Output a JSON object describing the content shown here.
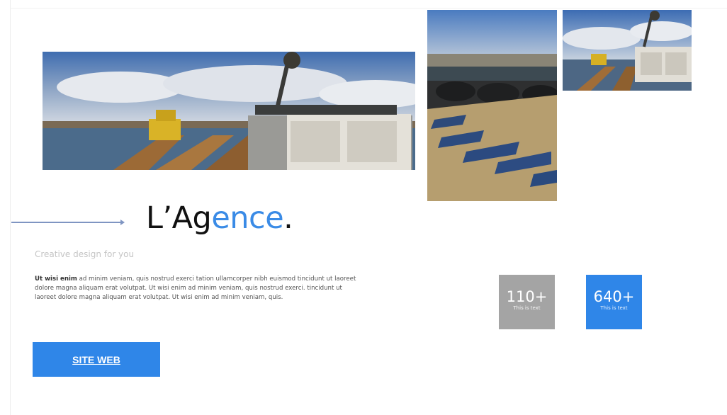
{
  "hero": {
    "title_main": "L’Ag",
    "title_accent": "ence",
    "title_end": ".",
    "subtitle": "Creative design for you",
    "body_bold": "Ut wisi enim",
    "body_text": " ad minim veniam, quis nostrud exerci tation ullamcorper nibh euismod tincidunt ut laoreet dolore magna aliquam erat volutpat. Ut wisi enim ad minim veniam, quis nostrud exerci. tincidunt ut laoreet dolore magna aliquam erat volutpat. Ut wisi enim ad minim veniam, quis.",
    "button_label": "SITE WEB"
  },
  "stats": [
    {
      "value": "110+",
      "label": "This is text",
      "color": "#a4a4a4"
    },
    {
      "value": "640+",
      "label": "This is text",
      "color": "#2f86e8"
    }
  ],
  "colors": {
    "accent": "#3a8be6",
    "button": "#2f86e8",
    "arrow": "#7f95c2"
  }
}
